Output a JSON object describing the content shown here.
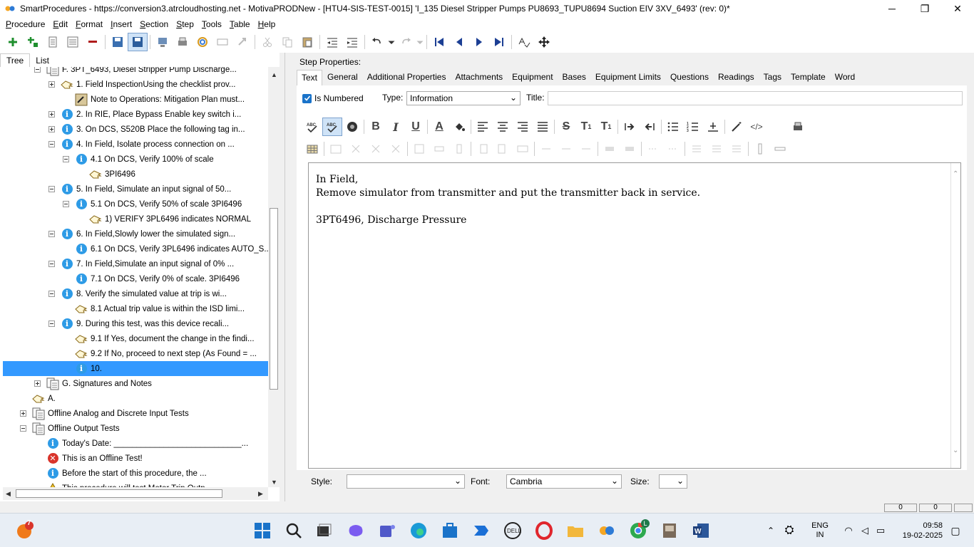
{
  "window": {
    "title": "SmartProcedures - https://conversion3.atrcloudhosting.net - MotivaPRODNew - [HTU4-SIS-TEST-0015] 'I_135 Diesel Stripper Pumps PU8693_TUPU8694 Suction EIV 3XV_6493' (rev: 0)*",
    "minimize": "─",
    "restore": "❐",
    "close": "✕"
  },
  "menu": [
    {
      "underlined": "P",
      "rest": "rocedure"
    },
    {
      "underlined": "E",
      "rest": "dit"
    },
    {
      "underlined": "F",
      "rest": "ormat"
    },
    {
      "underlined": "I",
      "rest": "nsert"
    },
    {
      "underlined": "S",
      "rest": "ection"
    },
    {
      "underlined": "S",
      "rest": "tep"
    },
    {
      "underlined": "T",
      "rest": "ools"
    },
    {
      "underlined": "T",
      "rest": "able"
    },
    {
      "underlined": "H",
      "rest": "elp"
    }
  ],
  "left_tabs": {
    "tree": "Tree",
    "list": "List"
  },
  "tree_nodes": [
    {
      "text": "F. 3PT_6493, Diesel Stripper Pump Discharge...",
      "icon": "section-icon",
      "expander": "minus"
    },
    {
      "text": "1. Field InspectionUsing the checklist prov...",
      "icon": "hand-icon",
      "expander": "plus"
    },
    {
      "text": "Note to Operations: Mitigation Plan must...",
      "icon": "note-icon",
      "expander": ""
    },
    {
      "text": "2. In RIE, Place Bypass Enable key switch i...",
      "icon": "info-icon",
      "expander": "plus"
    },
    {
      "text": "3. On DCS, S520B Place the following tag in...",
      "icon": "info-icon",
      "expander": "plus"
    },
    {
      "text": "4. In Field, Isolate process connection on ...",
      "icon": "info-icon",
      "expander": "minus"
    },
    {
      "text": "4.1 On DCS, Verify 100% of scale",
      "icon": "info-icon",
      "expander": "minus"
    },
    {
      "text": "3PI6496",
      "icon": "hand-icon",
      "expander": ""
    },
    {
      "text": "5. In Field, Simulate an input signal of 50...",
      "icon": "info-icon",
      "expander": "minus"
    },
    {
      "text": "5.1 On DCS, Verify 50% of scale 3PI6496",
      "icon": "info-icon",
      "expander": "minus"
    },
    {
      "text": "1) VERIFY 3PL6496 indicates NORMAL",
      "icon": "hand-icon",
      "expander": ""
    },
    {
      "text": "6. In Field,Slowly lower the simulated sign...",
      "icon": "info-icon",
      "expander": "minus"
    },
    {
      "text": "6.1  On DCS,  Verify 3PL6496  indicates AUTO_S...",
      "icon": "info-icon",
      "expander": ""
    },
    {
      "text": "7. In Field,Simulate an input signal of 0% ...",
      "icon": "info-icon",
      "expander": "minus"
    },
    {
      "text": "7.1 On DCS, Verify 0% of scale. 3PI6496",
      "icon": "info-icon",
      "expander": ""
    },
    {
      "text": "8. Verify the simulated value at trip is wi...",
      "icon": "info-icon",
      "expander": "minus"
    },
    {
      "text": "8.1 Actual trip value is within the ISD limi...",
      "icon": "hand-icon",
      "expander": ""
    },
    {
      "text": "9. During this test, was this device recali...",
      "icon": "info-icon",
      "expander": "minus"
    },
    {
      "text": "9.1 If Yes, document the change in the findi...",
      "icon": "hand-icon",
      "expander": ""
    },
    {
      "text": "9.2 If No, proceed to next step (As Found = ...",
      "icon": "hand-icon",
      "expander": ""
    },
    {
      "text": "10.",
      "icon": "info-icon",
      "expander": ""
    },
    {
      "text": "G. Signatures and Notes",
      "icon": "section-icon",
      "expander": "plus"
    },
    {
      "text": "A.",
      "icon": "hand-icon",
      "expander": ""
    },
    {
      "text": "Offline Analog and Discrete Input Tests",
      "icon": "section-icon",
      "expander": "plus"
    },
    {
      "text": "Offline Output Tests",
      "icon": "section-icon",
      "expander": "minus"
    },
    {
      "text": "Today's Date: ____________________________...",
      "icon": "info-icon",
      "expander": ""
    },
    {
      "text": "This is an Offline Test!",
      "icon": "error-icon",
      "expander": ""
    },
    {
      "text": "Before the start of this procedure, the ...",
      "icon": "info-icon",
      "expander": ""
    },
    {
      "text": "This procedure will test Motor Trip Outp...",
      "icon": "warning-icon",
      "expander": ""
    }
  ],
  "right": {
    "step_properties_label": "Step Properties:",
    "tabs": [
      "Text",
      "General",
      "Additional Properties",
      "Attachments",
      "Equipment",
      "Bases",
      "Equipment Limits",
      "Questions",
      "Readings",
      "Tags",
      "Template",
      "Word"
    ],
    "is_numbered_label": "Is Numbered",
    "is_numbered_checked": true,
    "type_label": "Type:",
    "type_value": "Information",
    "title_label": "Title:",
    "title_value": "",
    "editor_lines": [
      "In Field,",
      "Remove simulator from transmitter and put the transmitter back in service.",
      "",
      "3PT6496, Discharge Pressure"
    ],
    "style_label": "Style:",
    "style_value": "",
    "font_label": "Font:",
    "font_value": "Cambria",
    "size_label": "Size:",
    "size_value": ""
  },
  "status_cells": [
    "0",
    "0",
    ""
  ],
  "taskbar": {
    "notification_count": "7",
    "chrome_badge": "L",
    "lang_top": "ENG",
    "lang_bottom": "IN",
    "time": "09:58",
    "date": "19-02-2025"
  },
  "colors": {
    "selection": "#3399ff",
    "info_icon": "#2e9be6",
    "accent_blue": "#1a73c9"
  }
}
